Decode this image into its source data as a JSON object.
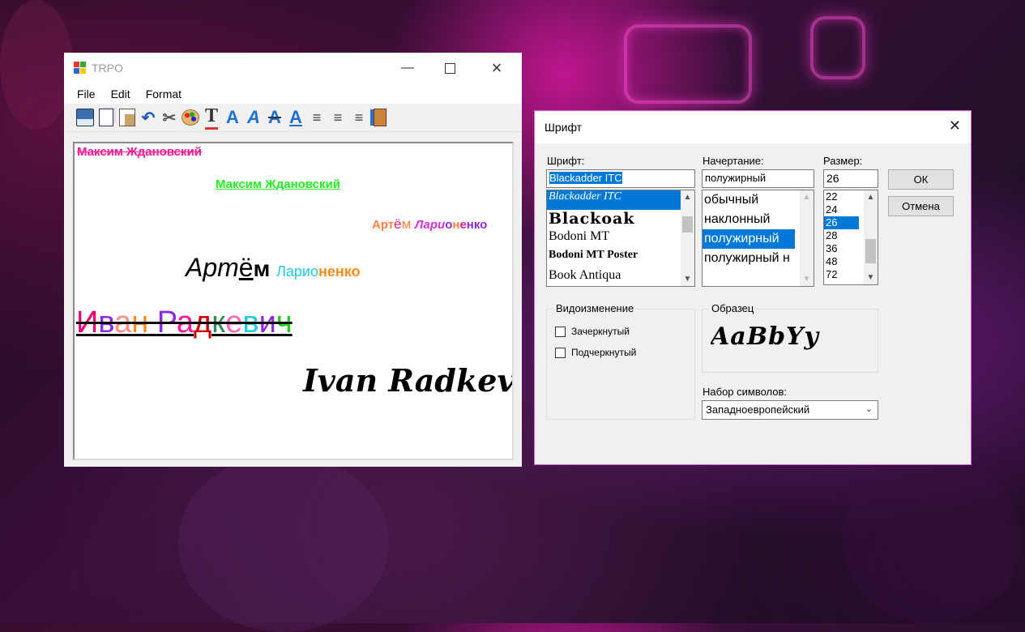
{
  "trpo": {
    "title": "TRPO",
    "menu": [
      "File",
      "Edit",
      "Format"
    ],
    "toolbar_icons": [
      "save-icon",
      "copy-icon",
      "paste-icon",
      "undo-icon",
      "cut-icon",
      "color-palette-icon",
      "text-color-icon",
      "bold-icon",
      "italic-icon",
      "strikethrough-icon",
      "underline-icon",
      "align-left-icon",
      "align-center-icon",
      "align-right-icon",
      "exit-icon"
    ],
    "lines": {
      "l1": "Максим Ждановский",
      "l2": "Максим Ждановский",
      "l3a": "Арт",
      "l3b": "ё",
      "l3c": "м ",
      "l3d": "Лари",
      "l3e": "о",
      "l3f": "н",
      "l3g": "е",
      "l3h": "нко",
      "l4a": "Арт",
      "l4b": "ё",
      "l4c": "м ",
      "l4d": "Ларио",
      "l4e": "ненко",
      "l5": [
        "И",
        "в",
        "а",
        "н",
        " ",
        "Р",
        "а",
        "д",
        "к",
        "е",
        "в",
        "и",
        "ч"
      ],
      "l6": "Ivan Radkevich"
    }
  },
  "dialog": {
    "title": "Шрифт",
    "font_label": "Шрифт:",
    "font_value": "Blackadder ITC",
    "fonts": [
      "Blackadder ITC",
      "Blackoak",
      "Bodoni MT",
      "Bodoni MT Poster",
      "Book Antiqua"
    ],
    "style_label": "Начертание:",
    "style_value": "полужирный",
    "styles": [
      "обычный",
      "наклонный",
      "полужирный",
      "полужирный н"
    ],
    "size_label": "Размер:",
    "size_value": "26",
    "sizes": [
      "22",
      "24",
      "26",
      "28",
      "36",
      "48",
      "72"
    ],
    "ok": "ОК",
    "cancel": "Отмена",
    "effects_label": "Видоизменение",
    "strike_label": "Зачеркнутый",
    "underline_label": "Подчеркнутый",
    "sample_label": "Образец",
    "sample_text": "AaBbYy",
    "charset_label": "Набор символов:",
    "charset_value": "Западноевропейский"
  }
}
